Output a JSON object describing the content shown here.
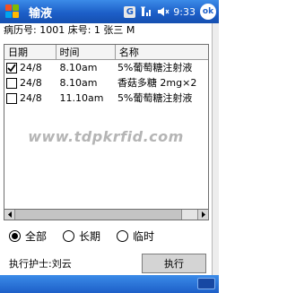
{
  "titlebar": {
    "app_title": "输液",
    "network_badge": "G",
    "clock": "9:33",
    "ok_label": "ok",
    "icons": [
      "windows-start-icon",
      "signal-icon",
      "speaker-icon"
    ]
  },
  "patient": {
    "text": "病历号: 1001 床号: 1 张三 M"
  },
  "table": {
    "headers": {
      "date": "日期",
      "time": "时间",
      "name": "名称"
    },
    "rows": [
      {
        "checked": true,
        "date": "24/8",
        "time": "8.10am",
        "name": "5%葡萄糖注射液"
      },
      {
        "checked": false,
        "date": "24/8",
        "time": "8.10am",
        "name": "香菇多糖 2mg×2"
      },
      {
        "checked": false,
        "date": "24/8",
        "time": "11.10am",
        "name": "5%葡萄糖注射液"
      }
    ]
  },
  "watermark": "www.tdpkrfid.com",
  "filters": {
    "selected": "all",
    "all": "全部",
    "long_term": "长期",
    "temporary": "临时"
  },
  "footer": {
    "nurse_label": "执行护士:刘云",
    "execute_label": "执行"
  },
  "colors": {
    "titlebar": "#1d5fc8",
    "accent": "#3b8be8"
  }
}
